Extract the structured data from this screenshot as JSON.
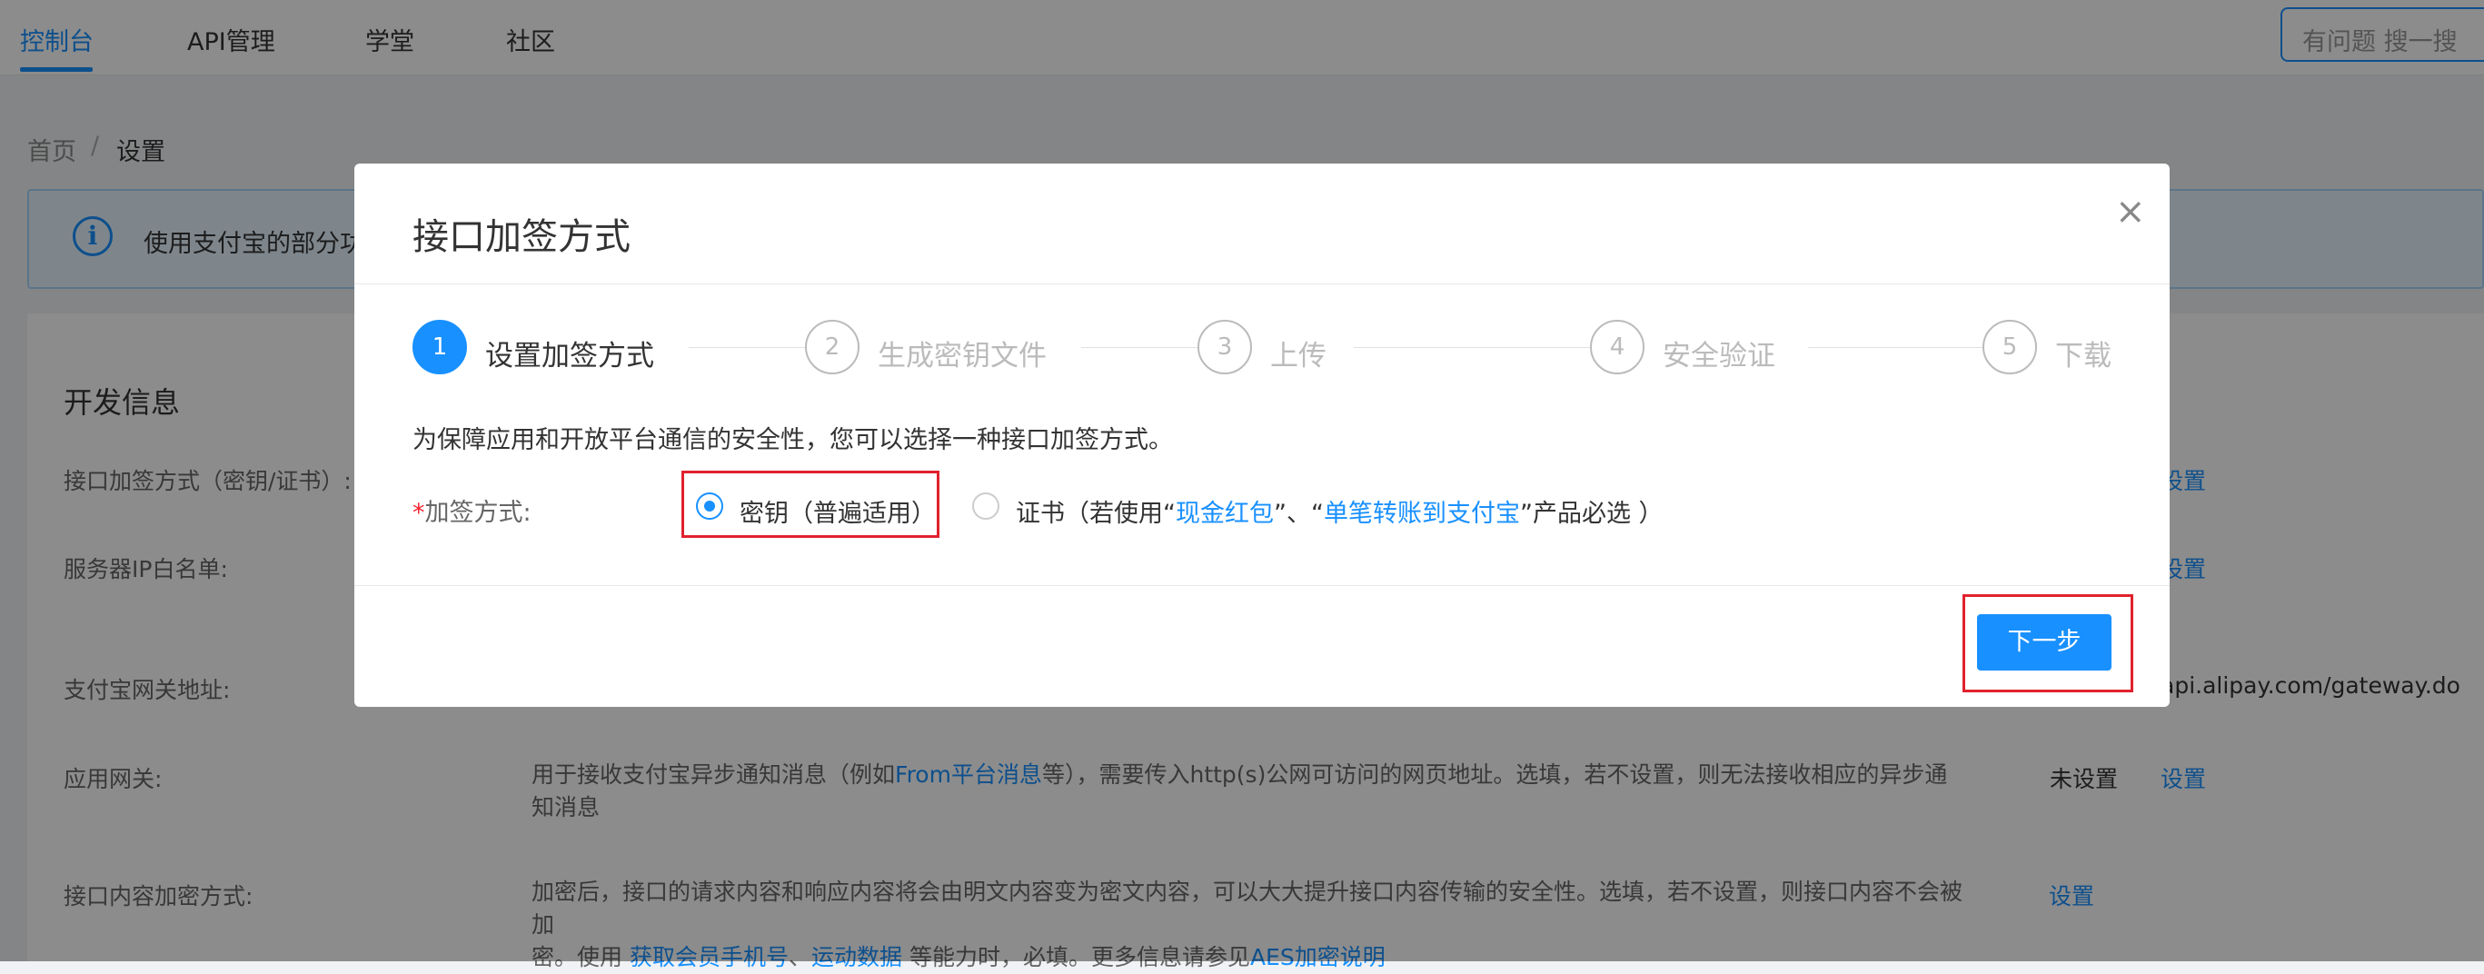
{
  "topnav": {
    "items": [
      "控制台",
      "API管理",
      "学堂",
      "社区"
    ],
    "search_label": "有问题 搜一搜"
  },
  "breadcrumb": {
    "home": "首页",
    "separator": "/",
    "current": "设置"
  },
  "banner": {
    "text": "使用支付宝的部分功能"
  },
  "dev_info": {
    "title": "开发信息",
    "rows": [
      {
        "label": "接口加签方式（密钥/证书）:",
        "link": "设置"
      },
      {
        "label": "服务器IP白名单:",
        "link": "设置"
      },
      {
        "label": "支付宝网关地址:",
        "value": "api.alipay.com/gateway.do"
      },
      {
        "label": "应用网关:",
        "desc_pre": "用于接收支付宝异步通知消息（例如",
        "desc_link": "From平台消息",
        "desc_post": "等），需要传入http(s)公网可访问的网页地址。选填，若不设置，则无法接收相应的异步通知消息",
        "status": "未设置",
        "link": "设置"
      },
      {
        "label": "接口内容加密方式:",
        "desc_line1": "加密后，接口的请求内容和响应内容将会由明文内容变为密文内容，可以大大提升接口内容传输的安全性。选填，若不设置，则接口内容不会被加",
        "desc_pre": "密。使用 ",
        "desc_link1": "获取会员手机号",
        "desc_sep": "、",
        "desc_link2": "运动数据",
        "desc_mid": " 等能力时，必填。更多信息请参见",
        "desc_link3": "AES加密说明",
        "link": "设置"
      }
    ]
  },
  "modal": {
    "title": "接口加签方式",
    "close_icon": "×",
    "steps": [
      {
        "num": "1",
        "label": "设置加签方式",
        "active": true
      },
      {
        "num": "2",
        "label": "生成密钥文件"
      },
      {
        "num": "3",
        "label": "上传"
      },
      {
        "num": "4",
        "label": "安全验证"
      },
      {
        "num": "5",
        "label": "下载"
      }
    ],
    "description": "为保障应用和开放平台通信的安全性，您可以选择一种接口加签方式。",
    "form_required_mark": "*",
    "form_label": "加签方式:",
    "options": {
      "key": {
        "label": "密钥（普遍适用）",
        "checked": true
      },
      "cert": {
        "label_pre": "证书（若使用“",
        "link1": "现金红包",
        "sep": "”、“",
        "link2": "单笔转账到支付宝",
        "label_post": "”产品必选 ）",
        "checked": false
      }
    },
    "next_button": "下一步"
  },
  "colors": {
    "accent": "#1890ff",
    "highlight": "#e0222d"
  }
}
